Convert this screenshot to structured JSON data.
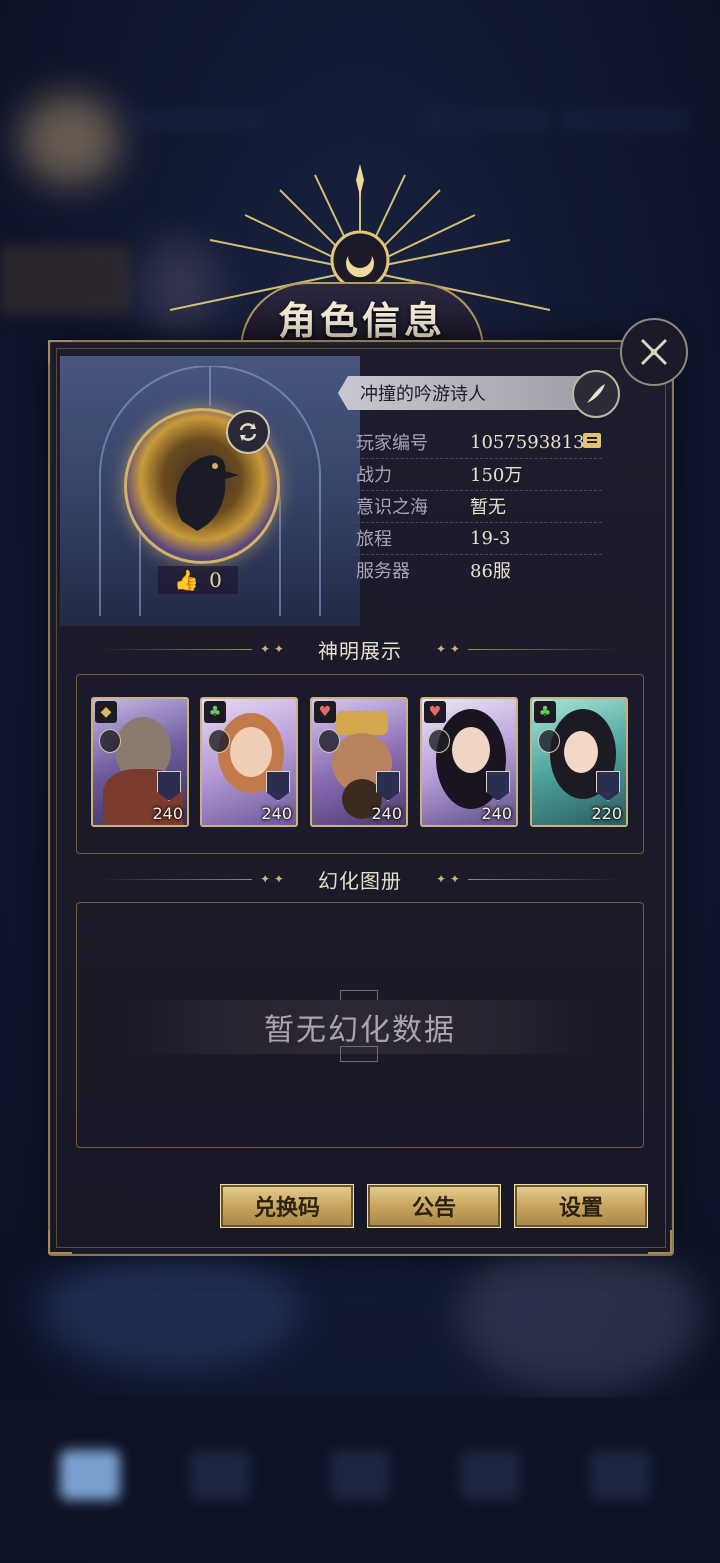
{
  "dialog": {
    "title": "角色信息",
    "player_name": "冲撞的吟游诗人",
    "info": [
      {
        "key": "玩家编号",
        "value": "10575938131"
      },
      {
        "key": "战力",
        "value": "150万"
      },
      {
        "key": "意识之海",
        "value": "暂无"
      },
      {
        "key": "旅程",
        "value": "19-3"
      },
      {
        "key": "服务器",
        "value": "86服"
      }
    ],
    "like_count": "0"
  },
  "sections": {
    "gods_title": "神明展示",
    "album_title": "幻化图册",
    "album_empty": "暂无幻化数据"
  },
  "cards": [
    {
      "suit": "diamond-icon",
      "level": "240",
      "color": "#8a6fb0"
    },
    {
      "suit": "club-icon",
      "level": "240",
      "color": "#9c86c6"
    },
    {
      "suit": "heart-icon",
      "level": "240",
      "color": "#7b5fa8"
    },
    {
      "suit": "heart-icon",
      "level": "240",
      "color": "#a48cc8"
    },
    {
      "suit": "club-icon",
      "level": "220",
      "color": "#4fa39c"
    }
  ],
  "buttons": {
    "redeem": "兑换码",
    "notice": "公告",
    "settings": "设置"
  },
  "colors": {
    "gold": "#c9a55e",
    "panel": "#1d1c2c",
    "accent_border": "#8c7a4f"
  }
}
